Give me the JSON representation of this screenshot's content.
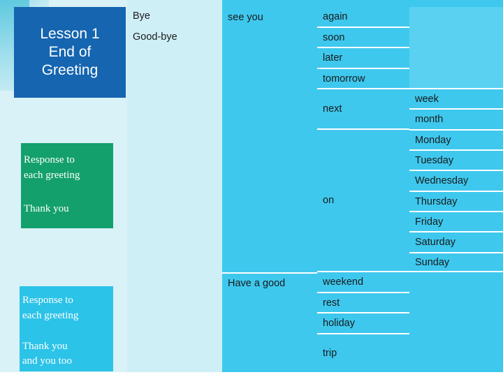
{
  "slide": {
    "lesson_title": "Lesson 1\nEnd of\nGreeting",
    "lesson_title_lines": [
      "Lesson 1",
      "End of",
      "Greeting"
    ],
    "green_box": {
      "line1": "Response to",
      "line2": "each greeting",
      "line3": "Thank you"
    },
    "cyan_box": {
      "line1": "Response to",
      "line2": "each greeting",
      "line3": "Thank you",
      "line4": "and you too"
    },
    "columns": {
      "col_a": [
        "Bye",
        "Good-bye"
      ],
      "col_b": [
        "see you",
        "Have a good"
      ],
      "col_c": [
        "again",
        "soon",
        "later",
        "tomorrow",
        "next",
        "on",
        "weekend",
        "rest",
        "holiday",
        "trip"
      ],
      "col_d": [
        "week",
        "month",
        "Monday",
        "Tuesday",
        "Wednesday",
        "Thursday",
        "Friday",
        "Saturday",
        "Sunday"
      ]
    },
    "colors": {
      "lesson_box": "#1565b0",
      "green_box": "#13a06c",
      "cyan_box": "#2cc3e8",
      "column_light": "#cfeff7",
      "column_bright": "#3ec8ee",
      "accent_top": "#0f7fd4"
    }
  }
}
